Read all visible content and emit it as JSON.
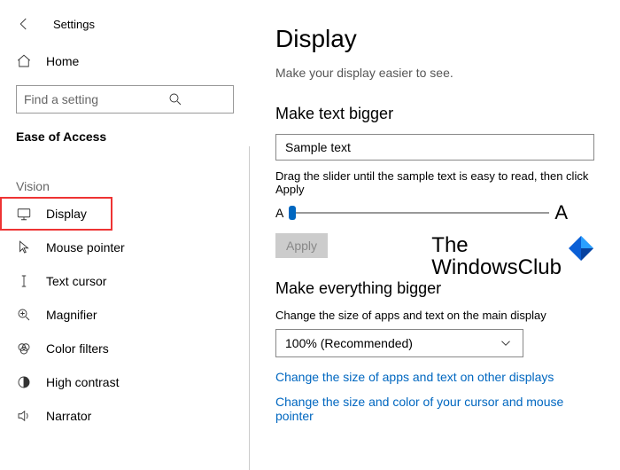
{
  "window": {
    "title": "Settings"
  },
  "sidebar": {
    "home": "Home",
    "search_placeholder": "Find a setting",
    "section": "Ease of Access",
    "group": "Vision",
    "items": [
      {
        "label": "Display"
      },
      {
        "label": "Mouse pointer"
      },
      {
        "label": "Text cursor"
      },
      {
        "label": "Magnifier"
      },
      {
        "label": "Color filters"
      },
      {
        "label": "High contrast"
      },
      {
        "label": "Narrator"
      }
    ]
  },
  "main": {
    "heading": "Display",
    "subtitle": "Make your display easier to see.",
    "text_bigger": {
      "heading": "Make text bigger",
      "sample": "Sample text",
      "instruction": "Drag the slider until the sample text is easy to read, then click Apply",
      "small_a": "A",
      "big_a": "A",
      "apply": "Apply"
    },
    "everything_bigger": {
      "heading": "Make everything bigger",
      "desc": "Change the size of apps and text on the main display",
      "dropdown_value": "100% (Recommended)",
      "link1": "Change the size of apps and text on other displays",
      "link2": "Change the size and color of your cursor and mouse pointer"
    }
  },
  "watermark": {
    "line1": "The",
    "line2": "WindowsClub"
  }
}
